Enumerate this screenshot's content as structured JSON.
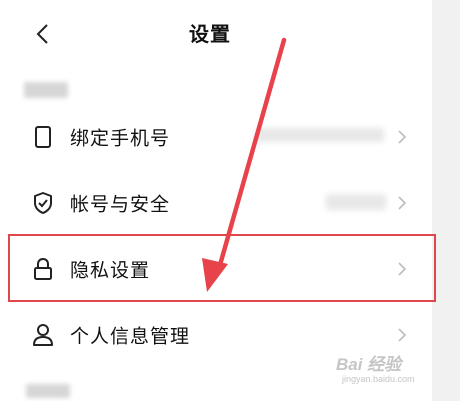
{
  "header": {
    "back_icon": "chevron-left-icon",
    "title": "设置"
  },
  "rows": [
    {
      "label": "绑定手机号",
      "icon": "phone-icon",
      "chevron_icon": "chevron-right-icon"
    },
    {
      "label": "帐号与安全",
      "icon": "shield-check-icon",
      "chevron_icon": "chevron-right-icon"
    },
    {
      "label": "隐私设置",
      "icon": "lock-icon",
      "chevron_icon": "chevron-right-icon"
    },
    {
      "label": "个人信息管理",
      "icon": "user-icon",
      "chevron_icon": "chevron-right-icon"
    }
  ],
  "annotation": {
    "highlight_color": "#e0474c",
    "arrow_color": "#e8434a"
  },
  "watermark": {
    "text": "Bai 经验",
    "sub": "jingyan.baidu.com"
  }
}
